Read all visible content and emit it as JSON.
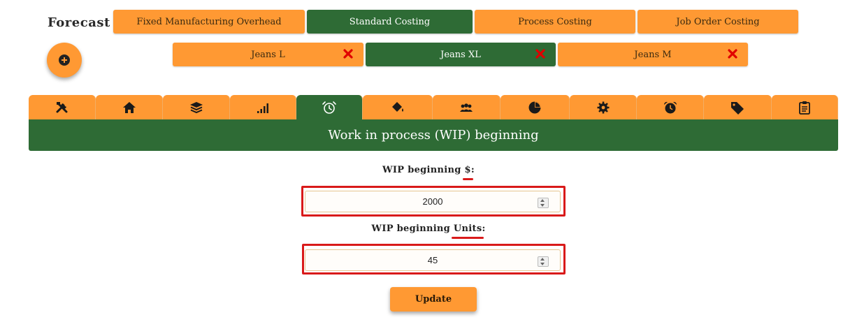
{
  "brand": {
    "title": "Forecast"
  },
  "method_tabs": [
    {
      "label": "Fixed Manufacturing Overhead",
      "active": false
    },
    {
      "label": "Standard Costing",
      "active": true
    },
    {
      "label": "Process Costing",
      "active": false
    },
    {
      "label": "Job Order Costing",
      "active": false
    }
  ],
  "products": [
    {
      "label": "Jeans L",
      "active": false
    },
    {
      "label": "Jeans XL",
      "active": true
    },
    {
      "label": "Jeans M",
      "active": false
    }
  ],
  "icon_tabs": [
    {
      "icon": "tools-icon",
      "active": false
    },
    {
      "icon": "home-icon",
      "active": false
    },
    {
      "icon": "layers-icon",
      "active": false
    },
    {
      "icon": "signal-bars-icon",
      "active": false
    },
    {
      "icon": "alarm-clock-outline-icon",
      "active": true
    },
    {
      "icon": "paint-bucket-icon",
      "active": false
    },
    {
      "icon": "users-icon",
      "active": false
    },
    {
      "icon": "pie-chart-icon",
      "active": false
    },
    {
      "icon": "gear-icon",
      "active": false
    },
    {
      "icon": "alarm-clock-icon",
      "active": false
    },
    {
      "icon": "tag-icon",
      "active": false
    },
    {
      "icon": "clipboard-icon",
      "active": false
    }
  ],
  "section": {
    "title": "Work in process (WIP) beginning"
  },
  "fields": {
    "wip_dollars": {
      "label_prefix": "WIP beginning ",
      "label_unit": "$",
      "label_suffix": ":",
      "value": "2000"
    },
    "wip_units": {
      "label_prefix": "WIP beginning ",
      "label_unit": "Units",
      "label_suffix": ":",
      "value": "45"
    }
  },
  "update_button": {
    "label": "Update"
  },
  "colors": {
    "orange": "#FF9933",
    "green": "#2E6B35",
    "red": "#D91A1A"
  }
}
